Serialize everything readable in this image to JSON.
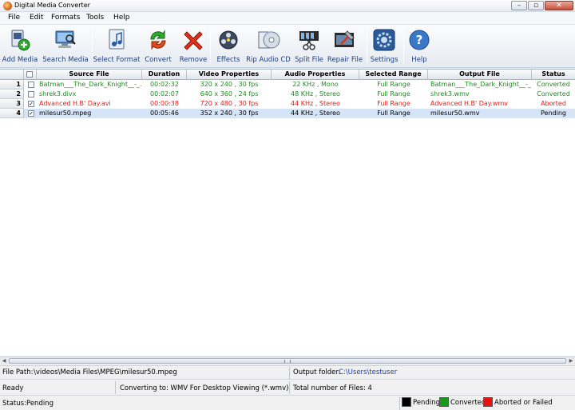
{
  "window": {
    "title": "Digital Media Converter"
  },
  "menu": [
    "File",
    "Edit",
    "Formats",
    "Tools",
    "Help"
  ],
  "toolbar": {
    "add_media": "Add Media",
    "search_media": "Search Media",
    "select_format": "Select Format",
    "convert": "Convert",
    "remove": "Remove",
    "effects": "Effects",
    "rip_audio_cd": "Rip Audio CD",
    "split_file": "Split File",
    "repair_file": "Repair File",
    "settings": "Settings",
    "help": "Help"
  },
  "table": {
    "columns": [
      "Source File",
      "Duration",
      "Video Properties",
      "Audio Properties",
      "Selected Range",
      "Output File",
      "Status"
    ],
    "rows": [
      {
        "num": "1",
        "checked": false,
        "source": "Batman___The_Dark_Knight__-_...",
        "duration": "00:02:32",
        "video": "320 x 240 , 30 fps",
        "audio": "22 KHz , Mono",
        "range": "Full Range",
        "output": "Batman___The_Dark_Knight__-_...",
        "status": "Converted",
        "state": "converted"
      },
      {
        "num": "2",
        "checked": false,
        "source": "shrek3.divx",
        "duration": "00:02:07",
        "video": "640 x 360 , 24 fps",
        "audio": "48 KHz , Stereo",
        "range": "Full Range",
        "output": "shrek3.wmv",
        "status": "Converted",
        "state": "converted"
      },
      {
        "num": "3",
        "checked": true,
        "source": "Advanced H.B' Day.avi",
        "duration": "00:00:38",
        "video": "720 x 480 , 30 fps",
        "audio": "44 KHz , Stereo",
        "range": "Full Range",
        "output": "Advanced H.B' Day.wmv",
        "status": "Aborted",
        "state": "aborted"
      },
      {
        "num": "4",
        "checked": true,
        "source": "milesur50.mpeg",
        "duration": "00:05:46",
        "video": "352 x 240 , 30 fps",
        "audio": "44 KHz , Stereo",
        "range": "Full Range",
        "output": "milesur50.wmv",
        "status": "Pending",
        "state": "pending"
      }
    ]
  },
  "info": {
    "file_path_label": "File Path:",
    "file_path": "\\videos\\Media Files\\MPEG\\milesur50.mpeg",
    "output_folder_label": "Output folder:",
    "output_folder": "C:\\Users\\testuser",
    "ready": "Ready",
    "converting_to": "Converting to: WMV For Desktop Viewing (*.wmv)",
    "total_files": "Total number of Files: 4"
  },
  "status_bar": {
    "status_label": "Status:",
    "status_value": "Pending",
    "legend": [
      {
        "label": "Pending",
        "color": "#000000"
      },
      {
        "label": "Converted",
        "color": "#1a9a1a"
      },
      {
        "label": "Aborted or Failed",
        "color": "#e81010"
      }
    ]
  },
  "colors": {
    "converted": "#1e8c1e",
    "aborted": "#e0201a",
    "pending": "#000000",
    "selected_row": "#d5e4f7"
  }
}
